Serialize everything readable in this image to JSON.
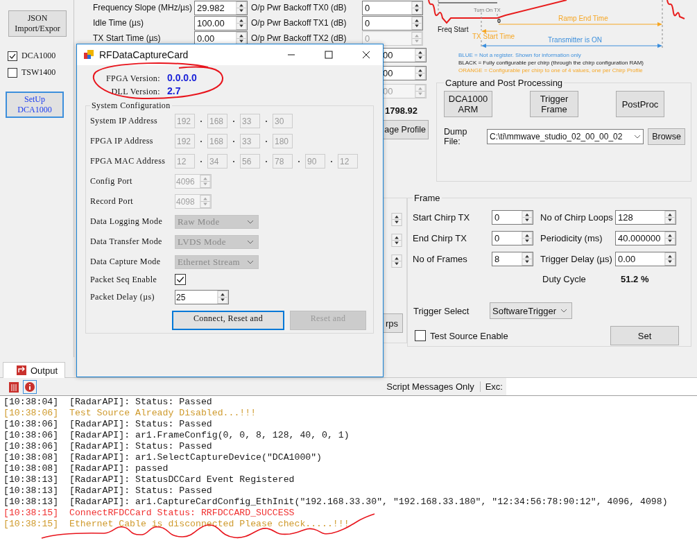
{
  "sidebar": {
    "json_button": [
      "JSON",
      "Import/Expor"
    ],
    "devices": [
      {
        "label": "DCA1000",
        "checked": true
      },
      {
        "label": "TSW1400",
        "checked": false
      }
    ],
    "setup_button": [
      "SetUp",
      "DCA1000"
    ]
  },
  "profile": {
    "rows": [
      {
        "label": "Frequency Slope (MHz/µs)",
        "value": "29.982",
        "right_label": "O/p Pwr Backoff TX0 (dB)",
        "right_value": "0",
        "disabled": false
      },
      {
        "label": "Idle Time (µs)",
        "value": "100.00",
        "right_label": "O/p Pwr Backoff TX1 (dB)",
        "right_value": "0",
        "disabled": false
      },
      {
        "label": "TX Start Time (µs)",
        "value": "0.00",
        "right_label": "O/p Pwr Backoff TX2 (dB)",
        "right_value": "0",
        "disabled": true
      }
    ],
    "covered_rows": [
      {
        "value": "00",
        "disabled": false
      },
      {
        "value": "00",
        "disabled": false
      },
      {
        "value": "00",
        "disabled": true
      }
    ],
    "readout": "1798.92",
    "button": "age Profile"
  },
  "diagram": {
    "turn_on_tx": "Turn On TX",
    "freq_start": "Freq Start",
    "origin": "0",
    "ramp_end": "Ramp End Time",
    "tx_start": "TX Start Time",
    "tx_on": "Transmitter is ON",
    "legend": [
      {
        "text": "BLUE = Not a register. Shown for information only",
        "kind": "info"
      },
      {
        "text": "BLACK = Fully configurable per chirp (through the chirp configuration RAM)",
        "kind": "chirp"
      },
      {
        "text": "ORANGE = Configurable per chirp to one of 4 values, one per Chirp Profile",
        "kind": "profile"
      }
    ]
  },
  "capture": {
    "title": "Capture and Post Processing",
    "buttons": [
      [
        "DCA1000",
        "ARM"
      ],
      [
        "Trigger",
        "Frame"
      ],
      [
        "PostProc"
      ]
    ],
    "dump_label": "Dump File:",
    "dump_value": "C:\\ti\\mmwave_studio_02_00_00_02",
    "browse": "Browse"
  },
  "side_panel": {
    "button": "rps"
  },
  "frame": {
    "title": "Frame",
    "fields": [
      {
        "label": "Start Chirp TX",
        "value": "0"
      },
      {
        "label": "No of Chirp Loops",
        "value": "128"
      },
      {
        "label": "End Chirp TX",
        "value": "0"
      },
      {
        "label": "Periodicity (ms)",
        "value": "40.000000"
      },
      {
        "label": "No of Frames",
        "value": "8"
      },
      {
        "label": "Trigger Delay (µs)",
        "value": "0.00"
      }
    ],
    "duty_label": "Duty Cycle",
    "duty_value": "51.2 %",
    "trigger_label": "Trigger Select",
    "trigger_value": "SoftwareTrigger",
    "test_source": {
      "label": "Test Source Enable",
      "checked": false
    },
    "set_button": "Set"
  },
  "dialog": {
    "title": "RFDataCaptureCard",
    "fpga_label": "FPGA Version:",
    "fpga_value": "0.0.0.0",
    "dll_label": "DLL Version:",
    "dll_value": "2.7",
    "group_title": "System Configuration",
    "address_rows": [
      {
        "label": "System IP Address",
        "parts": [
          "192",
          "168",
          "33",
          "30"
        ]
      },
      {
        "label": "FPGA IP Address",
        "parts": [
          "192",
          "168",
          "33",
          "180"
        ]
      },
      {
        "label": "FPGA MAC Address",
        "parts": [
          "12",
          "34",
          "56",
          "78",
          "90",
          "12"
        ]
      }
    ],
    "ports": [
      {
        "label": "Config Port",
        "value": "4096"
      },
      {
        "label": "Record Port",
        "value": "4098"
      }
    ],
    "modes": [
      {
        "label": "Data Logging Mode",
        "value": "Raw Mode"
      },
      {
        "label": "Data Transfer Mode",
        "value": "LVDS Mode"
      },
      {
        "label": "Data Capture Mode",
        "value": "Ethernet Stream"
      }
    ],
    "packet_seq": {
      "label": "Packet Seq Enable",
      "checked": true
    },
    "packet_delay": {
      "label": "Packet Delay (µs)",
      "value": "25"
    },
    "buttons": [
      {
        "label": "Connect, Reset and",
        "disabled": false
      },
      {
        "label": "Reset and",
        "disabled": true
      }
    ]
  },
  "output": {
    "tab": "Output",
    "filter": "Script Messages Only",
    "exc": "Exc:",
    "log": [
      {
        "time": "[10:38:04]",
        "text": "[RadarAPI]: Status: Passed",
        "kind": "info"
      },
      {
        "time": "[10:38:06]",
        "text": "Test Source Already Disabled...!!!",
        "kind": "warning"
      },
      {
        "time": "[10:38:06]",
        "text": "[RadarAPI]: Status: Passed",
        "kind": "info"
      },
      {
        "time": "[10:38:06]",
        "text": "[RadarAPI]: ar1.FrameConfig(0, 0, 8, 128, 40, 0, 1)",
        "kind": "info"
      },
      {
        "time": "[10:38:06]",
        "text": "[RadarAPI]: Status: Passed",
        "kind": "info"
      },
      {
        "time": "[10:38:08]",
        "text": "[RadarAPI]: ar1.SelectCaptureDevice(\"DCA1000\")",
        "kind": "info"
      },
      {
        "time": "[10:38:08]",
        "text": "[RadarAPI]: passed",
        "kind": "info"
      },
      {
        "time": "[10:38:13]",
        "text": "[RadarAPI]: StatusDCCard Event Registered",
        "kind": "info"
      },
      {
        "time": "[10:38:13]",
        "text": "[RadarAPI]: Status: Passed",
        "kind": "info"
      },
      {
        "time": "[10:38:13]",
        "text": "[RadarAPI]: ar1.CaptureCardConfig_EthInit(\"192.168.33.30\", \"192.168.33.180\", \"12:34:56:78:90:12\", 4096, 4098)",
        "kind": "info"
      },
      {
        "time": "[10:38:15]",
        "text": "ConnectRFDCCard Status: RRFDCCARD_SUCCESS",
        "kind": "error"
      },
      {
        "time": "[10:38:15]",
        "text": "Ethernet Cable is disconnected Please check.....!!!",
        "kind": "warning"
      }
    ]
  }
}
